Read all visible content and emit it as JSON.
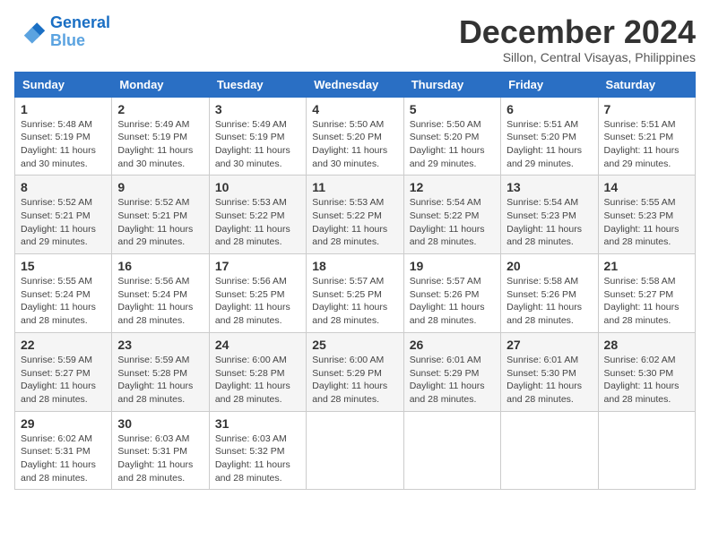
{
  "header": {
    "logo_line1": "General",
    "logo_line2": "Blue",
    "month": "December 2024",
    "location": "Sillon, Central Visayas, Philippines"
  },
  "columns": [
    "Sunday",
    "Monday",
    "Tuesday",
    "Wednesday",
    "Thursday",
    "Friday",
    "Saturday"
  ],
  "weeks": [
    [
      {
        "day": "1",
        "sunrise": "5:48 AM",
        "sunset": "5:19 PM",
        "daylight": "11 hours and 30 minutes."
      },
      {
        "day": "2",
        "sunrise": "5:49 AM",
        "sunset": "5:19 PM",
        "daylight": "11 hours and 30 minutes."
      },
      {
        "day": "3",
        "sunrise": "5:49 AM",
        "sunset": "5:19 PM",
        "daylight": "11 hours and 30 minutes."
      },
      {
        "day": "4",
        "sunrise": "5:50 AM",
        "sunset": "5:20 PM",
        "daylight": "11 hours and 30 minutes."
      },
      {
        "day": "5",
        "sunrise": "5:50 AM",
        "sunset": "5:20 PM",
        "daylight": "11 hours and 29 minutes."
      },
      {
        "day": "6",
        "sunrise": "5:51 AM",
        "sunset": "5:20 PM",
        "daylight": "11 hours and 29 minutes."
      },
      {
        "day": "7",
        "sunrise": "5:51 AM",
        "sunset": "5:21 PM",
        "daylight": "11 hours and 29 minutes."
      }
    ],
    [
      {
        "day": "8",
        "sunrise": "5:52 AM",
        "sunset": "5:21 PM",
        "daylight": "11 hours and 29 minutes."
      },
      {
        "day": "9",
        "sunrise": "5:52 AM",
        "sunset": "5:21 PM",
        "daylight": "11 hours and 29 minutes."
      },
      {
        "day": "10",
        "sunrise": "5:53 AM",
        "sunset": "5:22 PM",
        "daylight": "11 hours and 28 minutes."
      },
      {
        "day": "11",
        "sunrise": "5:53 AM",
        "sunset": "5:22 PM",
        "daylight": "11 hours and 28 minutes."
      },
      {
        "day": "12",
        "sunrise": "5:54 AM",
        "sunset": "5:22 PM",
        "daylight": "11 hours and 28 minutes."
      },
      {
        "day": "13",
        "sunrise": "5:54 AM",
        "sunset": "5:23 PM",
        "daylight": "11 hours and 28 minutes."
      },
      {
        "day": "14",
        "sunrise": "5:55 AM",
        "sunset": "5:23 PM",
        "daylight": "11 hours and 28 minutes."
      }
    ],
    [
      {
        "day": "15",
        "sunrise": "5:55 AM",
        "sunset": "5:24 PM",
        "daylight": "11 hours and 28 minutes."
      },
      {
        "day": "16",
        "sunrise": "5:56 AM",
        "sunset": "5:24 PM",
        "daylight": "11 hours and 28 minutes."
      },
      {
        "day": "17",
        "sunrise": "5:56 AM",
        "sunset": "5:25 PM",
        "daylight": "11 hours and 28 minutes."
      },
      {
        "day": "18",
        "sunrise": "5:57 AM",
        "sunset": "5:25 PM",
        "daylight": "11 hours and 28 minutes."
      },
      {
        "day": "19",
        "sunrise": "5:57 AM",
        "sunset": "5:26 PM",
        "daylight": "11 hours and 28 minutes."
      },
      {
        "day": "20",
        "sunrise": "5:58 AM",
        "sunset": "5:26 PM",
        "daylight": "11 hours and 28 minutes."
      },
      {
        "day": "21",
        "sunrise": "5:58 AM",
        "sunset": "5:27 PM",
        "daylight": "11 hours and 28 minutes."
      }
    ],
    [
      {
        "day": "22",
        "sunrise": "5:59 AM",
        "sunset": "5:27 PM",
        "daylight": "11 hours and 28 minutes."
      },
      {
        "day": "23",
        "sunrise": "5:59 AM",
        "sunset": "5:28 PM",
        "daylight": "11 hours and 28 minutes."
      },
      {
        "day": "24",
        "sunrise": "6:00 AM",
        "sunset": "5:28 PM",
        "daylight": "11 hours and 28 minutes."
      },
      {
        "day": "25",
        "sunrise": "6:00 AM",
        "sunset": "5:29 PM",
        "daylight": "11 hours and 28 minutes."
      },
      {
        "day": "26",
        "sunrise": "6:01 AM",
        "sunset": "5:29 PM",
        "daylight": "11 hours and 28 minutes."
      },
      {
        "day": "27",
        "sunrise": "6:01 AM",
        "sunset": "5:30 PM",
        "daylight": "11 hours and 28 minutes."
      },
      {
        "day": "28",
        "sunrise": "6:02 AM",
        "sunset": "5:30 PM",
        "daylight": "11 hours and 28 minutes."
      }
    ],
    [
      {
        "day": "29",
        "sunrise": "6:02 AM",
        "sunset": "5:31 PM",
        "daylight": "11 hours and 28 minutes."
      },
      {
        "day": "30",
        "sunrise": "6:03 AM",
        "sunset": "5:31 PM",
        "daylight": "11 hours and 28 minutes."
      },
      {
        "day": "31",
        "sunrise": "6:03 AM",
        "sunset": "5:32 PM",
        "daylight": "11 hours and 28 minutes."
      },
      null,
      null,
      null,
      null
    ]
  ]
}
